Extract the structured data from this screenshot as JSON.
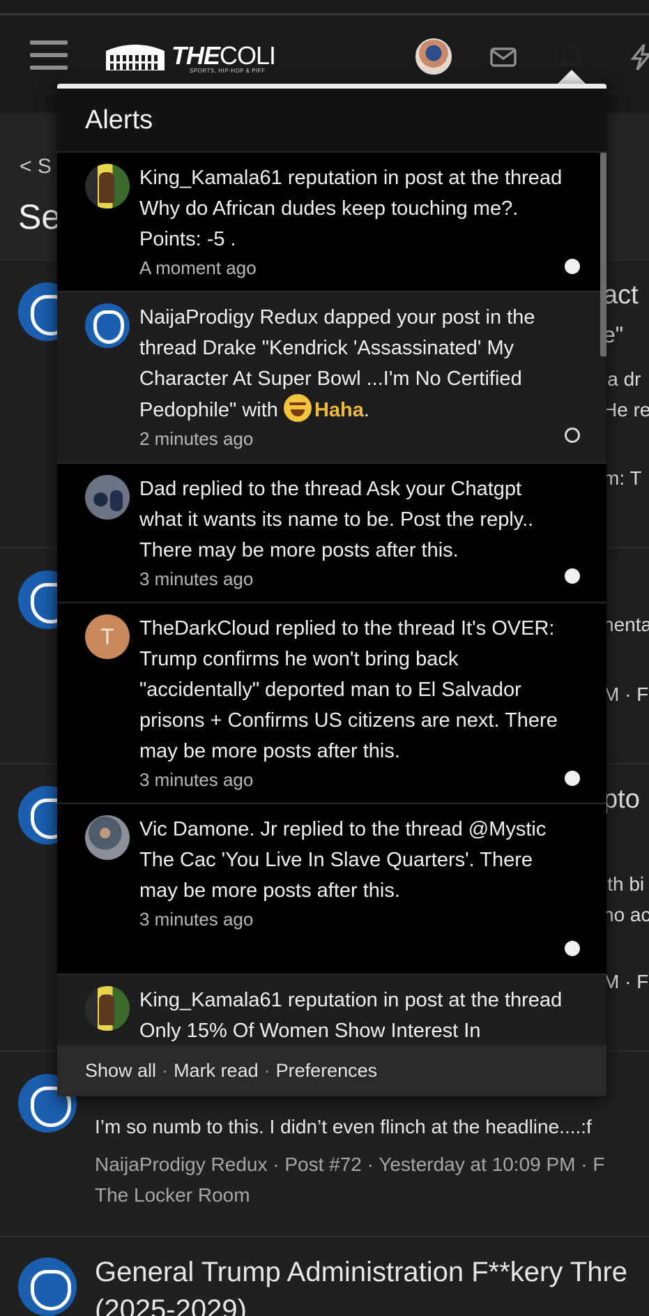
{
  "header": {
    "logo_main": "THE",
    "logo_rest": "COLI",
    "logo_tagline": "SPORTS, HIP-HOP & PIFF"
  },
  "background_page": {
    "back_label": "< S",
    "title_partial": "Se",
    "fragments": [
      "act",
      "e\"",
      "ia dr",
      "He re",
      "m: T",
      "nenta",
      "M · F",
      "pto",
      "ith bi",
      "no ac",
      "M · F"
    ],
    "row4": {
      "snippet": "I’m so numb to this. I didn’t even flinch at the headline....:f",
      "meta": "NaijaProdigy Redux · Post #72 · Yesterday at 10:09 PM · F",
      "forum": "The Locker Room"
    },
    "row5": {
      "title": "General Trump Administration F**kery Thre",
      "title_line2": "(2025-2029)"
    }
  },
  "alerts": {
    "heading": "Alerts",
    "items": [
      {
        "avatar": "king-avatar",
        "text": "King_Kamala61 reputation in post at the thread Why do African dudes keep touching me?. Points: -5 .",
        "time": "A moment ago",
        "status": "unread"
      },
      {
        "avatar": "duke-avatar",
        "text": "NaijaProdigy Redux dapped your post in the thread Drake \"Kendrick 'Assassinated' My Character At Super Bowl ...I'm No Certified Pedophile\" with",
        "reaction": "Haha",
        "time": "2 minutes ago",
        "status": "read"
      },
      {
        "avatar": "dad-avatar",
        "text": "Dad replied to the thread Ask your Chatgpt what it wants its name to be. Post the reply.. There may be more posts after this.",
        "time": "3 minutes ago",
        "status": "unread"
      },
      {
        "avatar": "letter-avatar",
        "avatar_letter": "T",
        "text": "TheDarkCloud replied to the thread It's OVER: Trump confirms he won't bring back \"accidentally\" deported man to El Salvador prisons + Confirms US citizens are next. There may be more posts after this.",
        "time": "3 minutes ago",
        "status": "unread"
      },
      {
        "avatar": "vic-avatar",
        "text": "Vic Damone. Jr replied to the thread @Mystic The Cac 'You Live In Slave Quarters'. There may be more posts after this.",
        "time": "3 minutes ago",
        "status": "unread"
      },
      {
        "avatar": "king-avatar",
        "text": "King_Kamala61 reputation in post at the thread Only 15% Of Women Show Interest In",
        "time": "",
        "status": "unread"
      }
    ],
    "footer": {
      "show_all": "Show all",
      "mark_read": "Mark read",
      "preferences": "Preferences",
      "separator": "·"
    }
  }
}
